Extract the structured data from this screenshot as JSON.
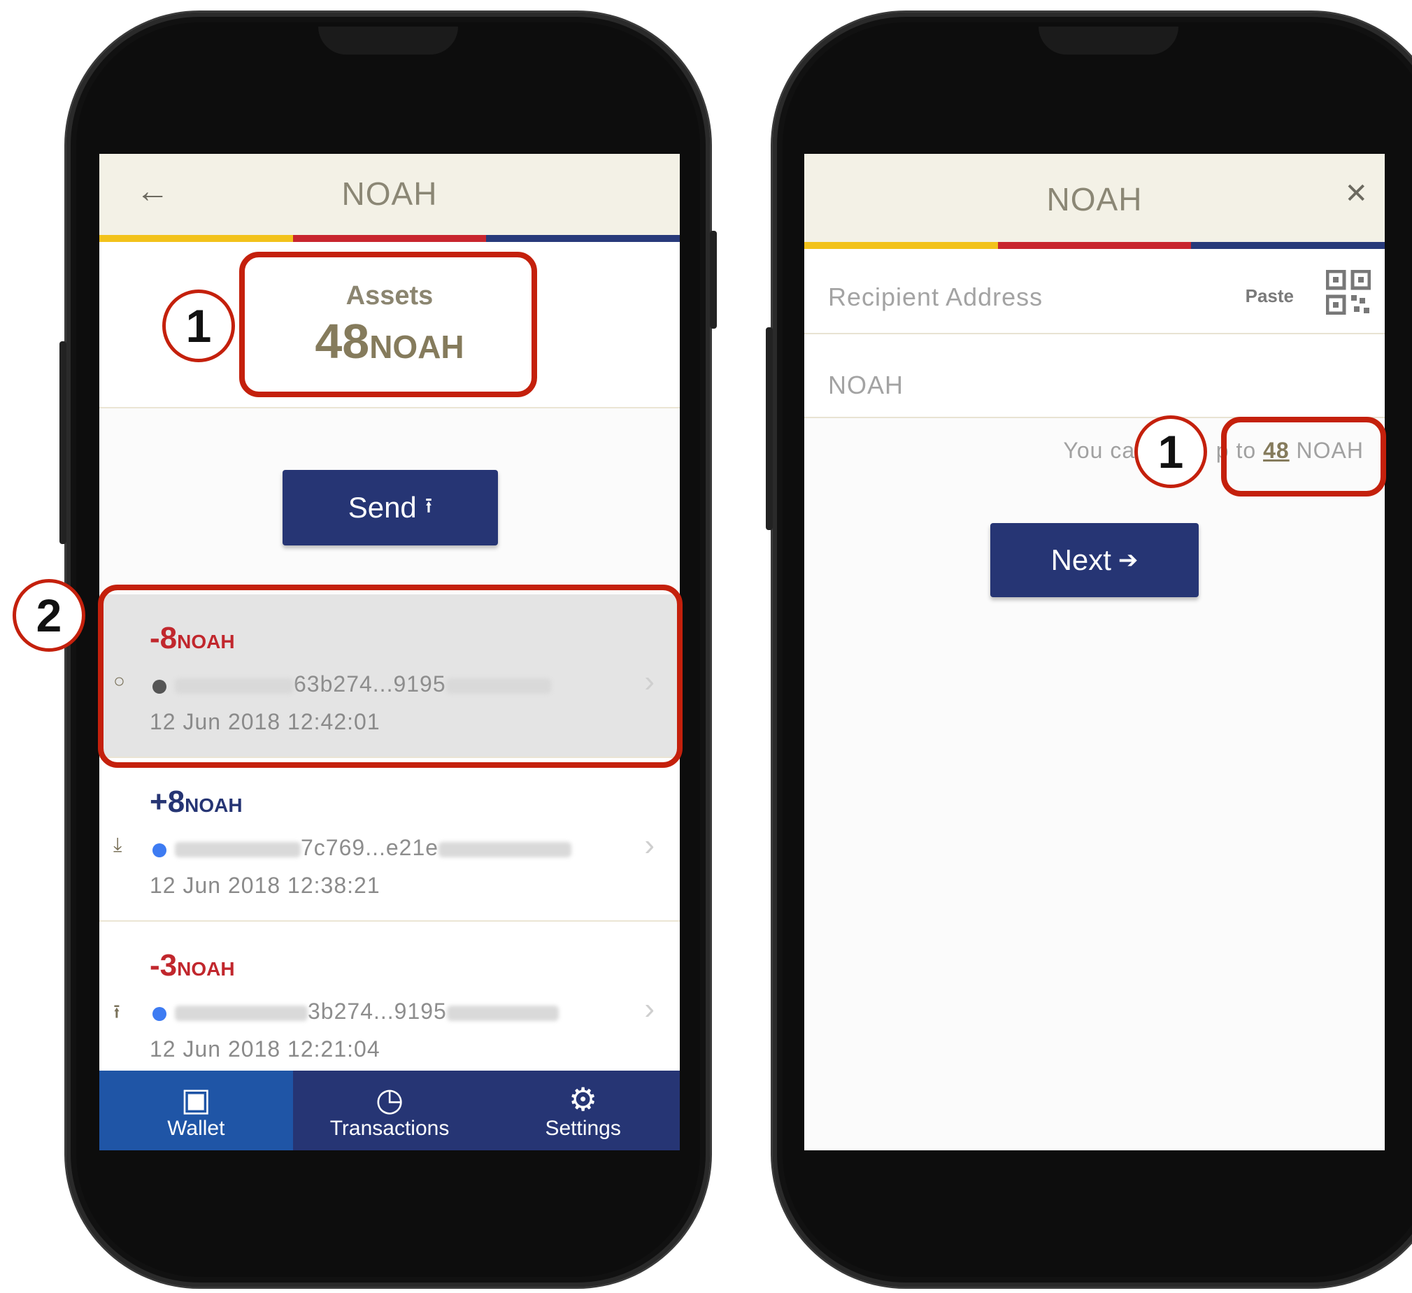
{
  "wallet_screen": {
    "header_title": "NOAH",
    "assets_label": "Assets",
    "assets_value": "48",
    "assets_unit": "NOAH",
    "send_label": "Send",
    "transactions": [
      {
        "amount": "-8",
        "unit": "NOAH",
        "direction": "pending",
        "address_visible": "63b274...9195",
        "date": "12 Jun 2018 12:42:01",
        "dot_color": "#555555"
      },
      {
        "amount": "+8",
        "unit": "NOAH",
        "direction": "receive",
        "address_visible": "7c769...e21e",
        "date": "12 Jun 2018 12:38:21",
        "dot_color": "#3d7bf2"
      },
      {
        "amount": "-3",
        "unit": "NOAH",
        "direction": "send",
        "address_visible": "3b274...9195",
        "date": "12 Jun 2018 12:21:04",
        "dot_color": "#3d7bf2"
      }
    ],
    "tabs": [
      {
        "label": "Wallet",
        "icon": "wallet-icon",
        "active": true
      },
      {
        "label": "Transactions",
        "icon": "clock-icon",
        "active": false
      },
      {
        "label": "Settings",
        "icon": "gear-icon",
        "active": false
      }
    ]
  },
  "send_screen": {
    "header_title": "NOAH",
    "recipient_placeholder": "Recipient Address",
    "paste_label": "Paste",
    "amount_placeholder": "NOAH",
    "available_prefix": "You can s",
    "available_mid": "p to ",
    "available_amount": "48",
    "available_unit": " NOAH",
    "next_label": "Next"
  },
  "annotations": {
    "marker_1": "1",
    "marker_2": "2"
  },
  "colors": {
    "brand_navy": "#263574",
    "accent_yellow": "#f2c21b",
    "accent_red": "#c8262e",
    "annotation_red": "#c4200c"
  }
}
